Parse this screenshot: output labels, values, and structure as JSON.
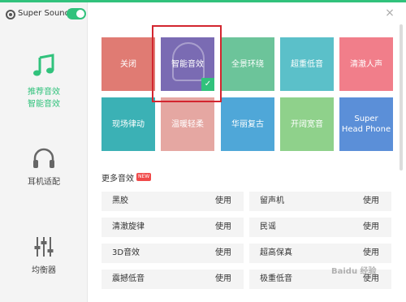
{
  "app": {
    "title": "Super Sound",
    "toggle_on": true
  },
  "sidebar": {
    "items": [
      {
        "label_line1": "推荐音效",
        "label_line2": "智能音效",
        "icon": "music-note-icon",
        "active": true
      },
      {
        "label": "耳机适配",
        "icon": "headphones-icon"
      },
      {
        "label": "均衡器",
        "icon": "equalizer-icon"
      }
    ]
  },
  "close_icon": "×",
  "presets": [
    {
      "label": "关闭"
    },
    {
      "label": "智能音效",
      "selected": true,
      "check": "✓"
    },
    {
      "label": "全景环绕"
    },
    {
      "label": "超重低音"
    },
    {
      "label": "清澈人声"
    },
    {
      "label": "现场律动"
    },
    {
      "label": "温暖轻柔"
    },
    {
      "label": "华丽复古"
    },
    {
      "label": "开阔宽音"
    },
    {
      "label_line1": "Super",
      "label_line2": "Head Phone"
    }
  ],
  "more": {
    "title": "更多音效",
    "badge": "NEW",
    "items": [
      {
        "name": "黑胶",
        "action": "使用"
      },
      {
        "name": "留声机",
        "action": "使用"
      },
      {
        "name": "清澈旋律",
        "action": "使用"
      },
      {
        "name": "民谣",
        "action": "使用"
      },
      {
        "name": "3D音效",
        "action": "使用"
      },
      {
        "name": "超高保真",
        "action": "使用"
      },
      {
        "name": "震撼低音",
        "action": "使用"
      },
      {
        "name": "极重低音",
        "action": "使用"
      }
    ]
  },
  "watermark": "Baidu 经验",
  "colors": {
    "accent": "#31c27c",
    "highlight": "#d3262f"
  }
}
